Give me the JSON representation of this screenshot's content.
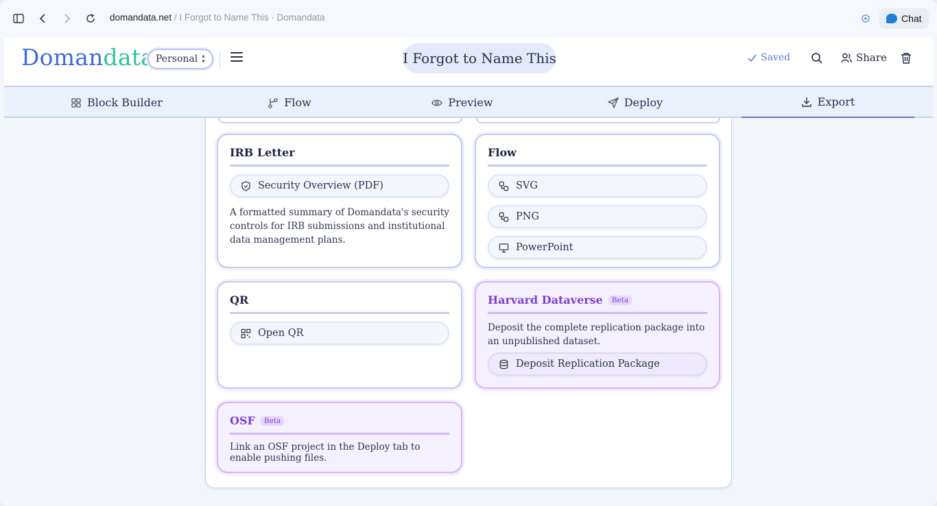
{
  "browser": {
    "url_domain": "domandata.net",
    "url_separator": "/",
    "page_title": "I Forgot to Name This · Domandata",
    "chat_label": "Chat"
  },
  "header": {
    "logo_part1": "Doman",
    "logo_part2": "data",
    "workspace": "Personal",
    "doc_title": "I Forgot to Name This",
    "saved_label": "Saved",
    "share_label": "Share"
  },
  "tabs": [
    {
      "label": "Block Builder",
      "icon": "grid-icon"
    },
    {
      "label": "Flow",
      "icon": "branch-icon"
    },
    {
      "label": "Preview",
      "icon": "eye-icon"
    },
    {
      "label": "Deploy",
      "icon": "send-icon"
    },
    {
      "label": "Export",
      "icon": "download-icon",
      "active": true
    }
  ],
  "cards": {
    "irb": {
      "title": "IRB Letter",
      "button": "Security Overview (PDF)",
      "description": "A formatted summary of Domandata's security controls for IRB submissions and institutional data management plans."
    },
    "flow": {
      "title": "Flow",
      "buttons": [
        "SVG",
        "PNG",
        "PowerPoint"
      ]
    },
    "qr": {
      "title": "QR",
      "button": "Open QR"
    },
    "dataverse": {
      "title": "Harvard Dataverse",
      "badge": "Beta",
      "description": "Deposit the complete replication package into an unpublished dataset.",
      "button": "Deposit Replication Package"
    },
    "osf": {
      "title": "OSF",
      "badge": "Beta",
      "description": "Link an OSF project in the Deploy tab to enable pushing files."
    }
  },
  "colors": {
    "logo_blue": "#3f6bd8",
    "logo_green": "#2fc1a0",
    "beta_purple": "#7d3fd2",
    "saved_blue": "#5d7bd6"
  }
}
